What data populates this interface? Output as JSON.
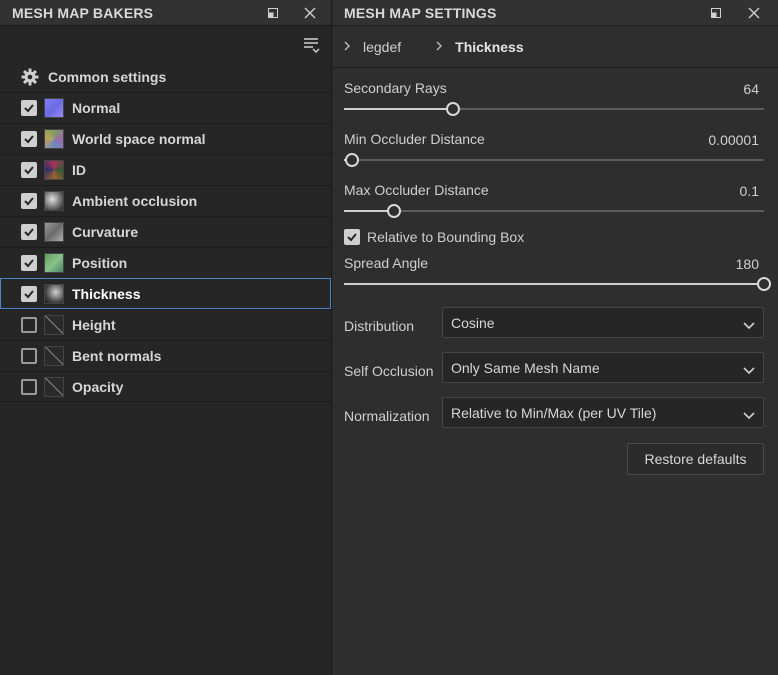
{
  "bakers_panel": {
    "title": "MESH MAP BAKERS",
    "common_settings_label": "Common settings",
    "items": [
      {
        "label": "Normal",
        "checked": true,
        "thumb": "normal-map-thumb",
        "color": "#7a7aff"
      },
      {
        "label": "World space normal",
        "checked": true,
        "thumb": "world-normal-thumb",
        "color": "#8a9a6a"
      },
      {
        "label": "ID",
        "checked": true,
        "thumb": "id-map-thumb",
        "color": "#a0306a"
      },
      {
        "label": "Ambient occlusion",
        "checked": true,
        "thumb": "ao-thumb",
        "color": "#cfcfcf"
      },
      {
        "label": "Curvature",
        "checked": true,
        "thumb": "curvature-thumb",
        "color": "#8a8a8a"
      },
      {
        "label": "Position",
        "checked": true,
        "thumb": "position-thumb",
        "color": "#6aa06a"
      },
      {
        "label": "Thickness",
        "checked": true,
        "thumb": "thickness-thumb",
        "color": "#9a9a9a",
        "selected": true
      },
      {
        "label": "Height",
        "checked": false,
        "thumb": "none"
      },
      {
        "label": "Bent normals",
        "checked": false,
        "thumb": "none"
      },
      {
        "label": "Opacity",
        "checked": false,
        "thumb": "none"
      }
    ]
  },
  "settings_panel": {
    "title": "MESH MAP SETTINGS",
    "breadcrumb": [
      "legdef",
      "Thickness"
    ],
    "sliders": [
      {
        "label": "Secondary Rays",
        "value": "64",
        "level": 0.26
      },
      {
        "label": "Min Occluder Distance",
        "value": "0.00001",
        "level": 0.02
      },
      {
        "label": "Max Occluder Distance",
        "value": "0.1",
        "level": 0.12
      }
    ],
    "relative_bbox": {
      "label": "Relative to Bounding Box",
      "checked": true
    },
    "spread_angle": {
      "label": "Spread Angle",
      "value": "180",
      "level": 1.0
    },
    "dropdowns": [
      {
        "label": "Distribution",
        "value": "Cosine"
      },
      {
        "label": "Self Occlusion",
        "value": "Only Same Mesh Name"
      },
      {
        "label": "Normalization",
        "value": "Relative to Min/Max (per UV Tile)"
      }
    ],
    "restore_label": "Restore defaults"
  }
}
